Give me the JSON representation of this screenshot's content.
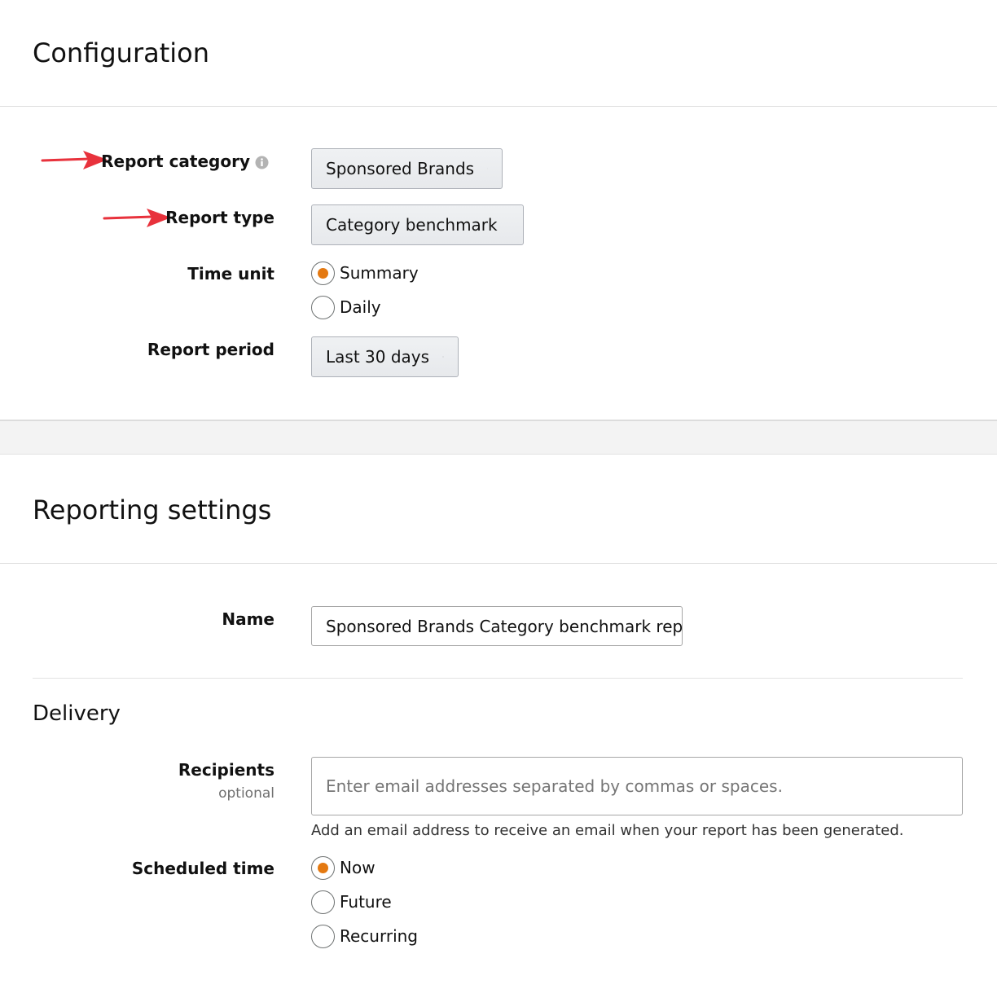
{
  "configuration": {
    "title": "Configuration",
    "report_category": {
      "label": "Report category",
      "value": "Sponsored Brands"
    },
    "report_type": {
      "label": "Report type",
      "value": "Category benchmark"
    },
    "time_unit": {
      "label": "Time unit",
      "options": [
        {
          "label": "Summary",
          "checked": true
        },
        {
          "label": "Daily",
          "checked": false
        }
      ]
    },
    "report_period": {
      "label": "Report period",
      "value": "Last 30 days"
    }
  },
  "reporting_settings": {
    "title": "Reporting settings",
    "name": {
      "label": "Name",
      "value": "Sponsored Brands Category benchmark repo"
    }
  },
  "delivery": {
    "title": "Delivery",
    "recipients": {
      "label": "Recipients",
      "sublabel": "optional",
      "placeholder": "Enter email addresses separated by commas or spaces.",
      "help": "Add an email address to receive an email when your report has been generated."
    },
    "scheduled_time": {
      "label": "Scheduled time",
      "options": [
        {
          "label": "Now",
          "checked": true
        },
        {
          "label": "Future",
          "checked": false
        },
        {
          "label": "Recurring",
          "checked": false
        }
      ]
    }
  },
  "colors": {
    "accent": "#e47911",
    "arrow": "#e8323c"
  }
}
